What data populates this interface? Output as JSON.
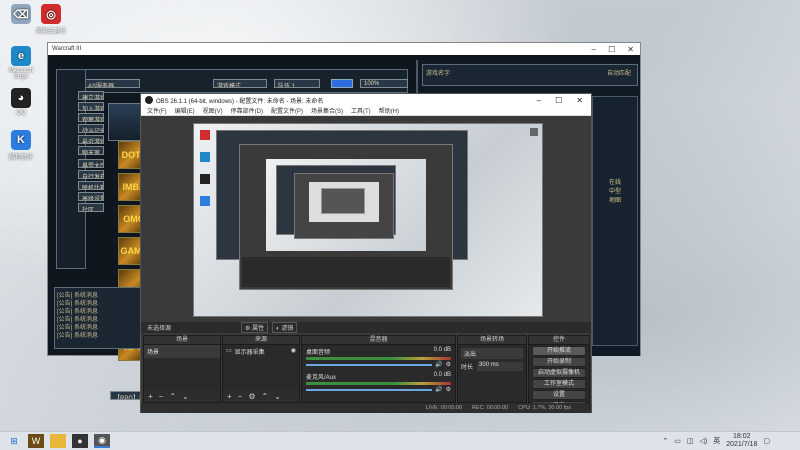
{
  "desktop": {
    "icons": [
      {
        "label": "",
        "name": "windows-recycle-icon",
        "color": "#8fa6bd",
        "glyph": "⌫"
      },
      {
        "label": "网易云音乐",
        "name": "netease-music-icon",
        "color": "#d12c2c",
        "glyph": "◎"
      },
      {
        "label": "Microsoft Edge",
        "name": "edge-icon",
        "color": "#1e88c8",
        "glyph": "e"
      },
      {
        "label": "QQ",
        "name": "qq-icon",
        "color": "#222",
        "glyph": "◕"
      },
      {
        "label": "酷狗音乐",
        "name": "kugou-icon",
        "color": "#2c7de0",
        "glyph": "K"
      }
    ]
  },
  "warcraft": {
    "title": "Warcraft III",
    "header": {
      "field1": "AS服务器",
      "field2": "游戏模式",
      "field3": "队伍 1",
      "field4": "100%",
      "right_title": "游戏名字",
      "right_label": "自动匹配"
    },
    "left_buttons": [
      "建立游戏",
      "加入游戏",
      "观察游戏",
      "战斗记录",
      "最近游戏",
      "聊天室"
    ],
    "left_buttons2": [
      "暴雪大厅",
      "自行发布",
      "联机比赛",
      "高级设置",
      "社区"
    ],
    "thumbs": [
      "DOTA",
      "IMBA",
      "OMG",
      "GAME",
      "",
      "",
      "RPG"
    ],
    "chat_lines": [
      "[公告] 系统消息",
      "[公告] 系统消息",
      "[公告] 系统消息",
      "[公告] 系统消息",
      "[公告] 系统消息",
      "[公告] 系统消息"
    ],
    "bottom_label": "【RPG】我的房间",
    "right_side": [
      "在线",
      "中型",
      "地图"
    ]
  },
  "obs": {
    "title": "OBS 26.1.1 (64-bit, windows) - 配置文件: 未命名 - 场景: 未命名",
    "menu": [
      "文件(F)",
      "编辑(E)",
      "视图(V)",
      "停靠部件(D)",
      "配置文件(P)",
      "场景集合(S)",
      "工具(T)",
      "帮助(H)"
    ],
    "scene_bar": {
      "label": "未选择源",
      "props": "属性",
      "filters": "滤镜"
    },
    "docks": {
      "scenes": {
        "header": "场景",
        "items": [
          "场景"
        ]
      },
      "sources": {
        "header": "来源",
        "items": [
          "显示器采集"
        ]
      },
      "mixer": {
        "header": "混音器",
        "channels": [
          {
            "name": "桌面音频",
            "db": "0.0 dB"
          },
          {
            "name": "麦克风/Aux",
            "db": "0.0 dB"
          }
        ]
      },
      "transitions": {
        "header": "场景转场",
        "type": "淡出",
        "duration_label": "时长",
        "duration": "300 ms"
      },
      "controls": {
        "header": "控件",
        "buttons": [
          "开始推流",
          "开始录制",
          "启动虚拟摄像机",
          "工作室模式",
          "设置",
          "退出"
        ]
      }
    },
    "status": [
      "LIVE: 00:00:00",
      "REC: 00:00:00",
      "CPU: 1.7%, 30.00 fps"
    ]
  },
  "taskbar": {
    "time": "18:02",
    "date": "2021/7/18",
    "apps": [
      "start-icon",
      "warcraft-icon",
      "file-explorer-icon",
      "obs-taskbar-icon",
      "obs-icon"
    ]
  }
}
